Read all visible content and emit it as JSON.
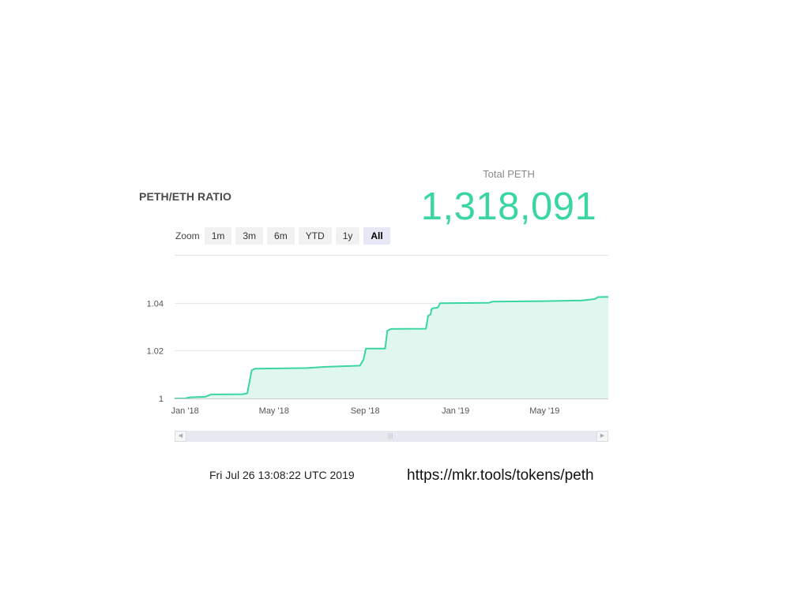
{
  "section_title": "PETH/ETH RATIO",
  "total": {
    "label": "Total PETH",
    "value": "1,318,091",
    "color": "#39d6a4"
  },
  "zoom": {
    "label": "Zoom",
    "buttons": [
      {
        "label": "1m",
        "active": false
      },
      {
        "label": "3m",
        "active": false
      },
      {
        "label": "6m",
        "active": false
      },
      {
        "label": "YTD",
        "active": false
      },
      {
        "label": "1y",
        "active": false
      },
      {
        "label": "All",
        "active": true
      }
    ]
  },
  "navigator": {
    "left_arrow_icon": "chevron-left-icon",
    "right_arrow_icon": "chevron-right-icon",
    "grip": "|||"
  },
  "footer": {
    "timestamp": "Fri Jul 26 13:08:22 UTC 2019",
    "url": "https://mkr.tools/tokens/peth"
  },
  "chart_data": {
    "type": "area",
    "title": "",
    "xlabel": "",
    "ylabel": "",
    "line_color": "#39d6a4",
    "fill_color": "#dff7ef",
    "grid": true,
    "x_axis": {
      "type": "datetime",
      "range": [
        "2017-12-18",
        "2019-07-26"
      ],
      "ticks": [
        {
          "date": "2018-01-01",
          "label": "Jan '18"
        },
        {
          "date": "2018-05-01",
          "label": "May '18"
        },
        {
          "date": "2018-09-01",
          "label": "Sep '18"
        },
        {
          "date": "2019-01-01",
          "label": "Jan '19"
        },
        {
          "date": "2019-05-01",
          "label": "May '19"
        }
      ]
    },
    "y_axis": {
      "range": [
        1.0,
        1.06
      ],
      "ticks": [
        {
          "value": 1.0,
          "label": "1"
        },
        {
          "value": 1.02,
          "label": "1.02"
        },
        {
          "value": 1.04,
          "label": "1.04"
        }
      ]
    },
    "series": [
      {
        "points": [
          [
            "2017-12-18",
            1.0
          ],
          [
            "2018-01-01",
            1.0
          ],
          [
            "2018-01-08",
            1.0005
          ],
          [
            "2018-01-28",
            1.0007
          ],
          [
            "2018-02-05",
            1.0017
          ],
          [
            "2018-03-20",
            1.0018
          ],
          [
            "2018-03-26",
            1.0022
          ],
          [
            "2018-04-01",
            1.0118
          ],
          [
            "2018-04-05",
            1.0125
          ],
          [
            "2018-06-15",
            1.0128
          ],
          [
            "2018-07-10",
            1.0133
          ],
          [
            "2018-08-25",
            1.0138
          ],
          [
            "2018-08-30",
            1.0165
          ],
          [
            "2018-09-02",
            1.021
          ],
          [
            "2018-09-28",
            1.021
          ],
          [
            "2018-10-01",
            1.0285
          ],
          [
            "2018-10-06",
            1.0292
          ],
          [
            "2018-11-22",
            1.0293
          ],
          [
            "2018-11-25",
            1.0348
          ],
          [
            "2018-11-28",
            1.0352
          ],
          [
            "2018-11-30",
            1.0378
          ],
          [
            "2018-12-08",
            1.0382
          ],
          [
            "2018-12-11",
            1.04
          ],
          [
            "2019-02-15",
            1.0402
          ],
          [
            "2019-02-20",
            1.0407
          ],
          [
            "2019-05-01",
            1.0409
          ],
          [
            "2019-06-20",
            1.0412
          ],
          [
            "2019-07-01",
            1.0415
          ],
          [
            "2019-07-08",
            1.0418
          ],
          [
            "2019-07-12",
            1.0426
          ],
          [
            "2019-07-26",
            1.0427
          ]
        ]
      }
    ]
  }
}
